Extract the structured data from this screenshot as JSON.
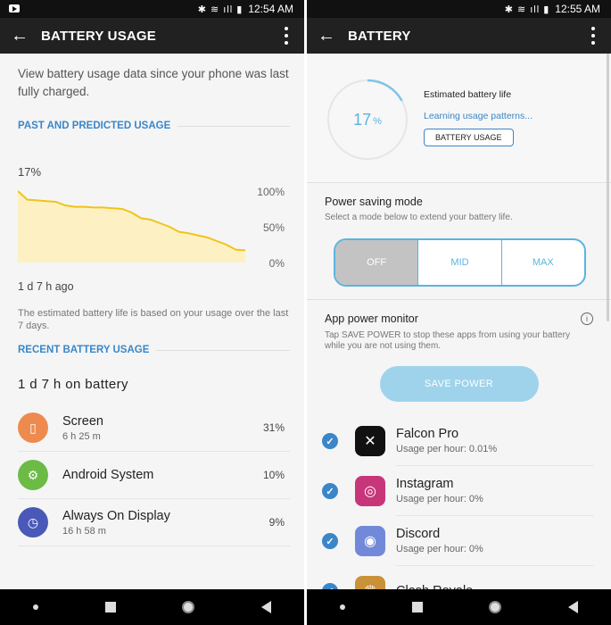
{
  "left": {
    "status": {
      "time": "12:54 AM",
      "icons": "✱ ≋ ıll ▮"
    },
    "appbar": {
      "title": "BATTERY USAGE"
    },
    "intro": "View battery usage data since your phone was last fully charged.",
    "past_heading": "PAST AND PREDICTED USAGE",
    "current_pct": "17%",
    "since_label": "1 d 7 h ago",
    "note": "The estimated battery life is based on your usage over the last 7 days.",
    "recent_heading": "RECENT BATTERY USAGE",
    "on_battery": "1 d 7 h on battery",
    "apps": [
      {
        "name": "Screen",
        "sub": "6 h 25 m",
        "value": "31%",
        "color": "#ef8a4f",
        "icon": "phone-icon"
      },
      {
        "name": "Android System",
        "sub": "",
        "value": "10%",
        "color": "#6bbb45",
        "icon": "gear-icon"
      },
      {
        "name": "Always On Display",
        "sub": "16 h 58 m",
        "value": "9%",
        "color": "#4a59b8",
        "icon": "aod-icon"
      }
    ]
  },
  "chart_data": {
    "type": "line",
    "yticks": [
      "100%",
      "50%",
      "0%"
    ],
    "ylim": [
      0,
      100
    ],
    "series": [
      {
        "values": [
          100,
          88,
          87,
          86,
          85,
          80,
          78,
          78,
          77,
          77,
          76,
          75,
          70,
          62,
          60,
          55,
          50,
          43,
          41,
          38,
          35,
          30,
          25,
          18,
          17
        ]
      }
    ],
    "line_color": "#f0c419",
    "fill_color": "#fdf1c4"
  },
  "right": {
    "status": {
      "time": "12:55 AM",
      "icons": "✱ ≋ ıll ▮"
    },
    "appbar": {
      "title": "BATTERY"
    },
    "gauge": {
      "value": "17",
      "unit": "%",
      "fraction": 0.17
    },
    "est_label": "Estimated battery life",
    "learning": "Learning usage patterns...",
    "battery_usage_btn": "BATTERY USAGE",
    "psm": {
      "title": "Power saving mode",
      "subtitle": "Select a mode below to extend your battery life.",
      "options": [
        "OFF",
        "MID",
        "MAX"
      ],
      "selected": "OFF"
    },
    "apm": {
      "title": "App power monitor",
      "subtitle": "Tap SAVE POWER to stop these apps from using your battery while you are not using them.",
      "save_btn": "SAVE POWER"
    },
    "apps": [
      {
        "name": "Falcon Pro",
        "sub": "Usage per hour: 0.01%",
        "color": "#111",
        "icon": "falcon-icon"
      },
      {
        "name": "Instagram",
        "sub": "Usage per hour: 0%",
        "color": "#c8367a",
        "icon": "instagram-icon"
      },
      {
        "name": "Discord",
        "sub": "Usage per hour: 0%",
        "color": "#7289da",
        "icon": "discord-icon"
      },
      {
        "name": "Clash Royale",
        "sub": "",
        "color": "#c99238",
        "icon": "clash-icon"
      }
    ]
  }
}
